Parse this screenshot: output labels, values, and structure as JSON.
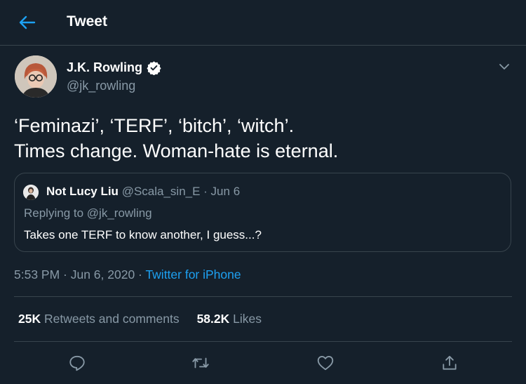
{
  "header": {
    "title": "Tweet",
    "back_icon": "arrow-left-icon",
    "accent": "#1da1f2"
  },
  "tweet": {
    "author_name": "J.K. Rowling",
    "author_handle": "@jk_rowling",
    "verified_icon": "verified-badge-icon",
    "text_lines": [
      "‘Feminazi’, ‘TERF’, ‘bitch’, ‘witch’.",
      "Times change. Woman-hate is eternal."
    ],
    "quoted": {
      "name": "Not Lucy Liu",
      "handle_date": "@Scala_sin_E · Jun 6",
      "replying_prefix": "Replying to",
      "replying_handle": "@jk_rowling",
      "text": "Takes one TERF to know another, I guess...?"
    },
    "timestamp": "5:53 PM · Jun 6, 2020 ·",
    "source": "Twitter for iPhone",
    "stats": {
      "retweets_count": "25K",
      "retweets_label": "Retweets and comments",
      "likes_count": "58.2K",
      "likes_label": "Likes"
    }
  },
  "actions": [
    "reply-icon",
    "retweet-icon",
    "like-icon",
    "share-icon"
  ],
  "colors": {
    "background": "#15202b",
    "border": "#38444d",
    "muted": "#8899a6",
    "link": "#1da1f2"
  }
}
